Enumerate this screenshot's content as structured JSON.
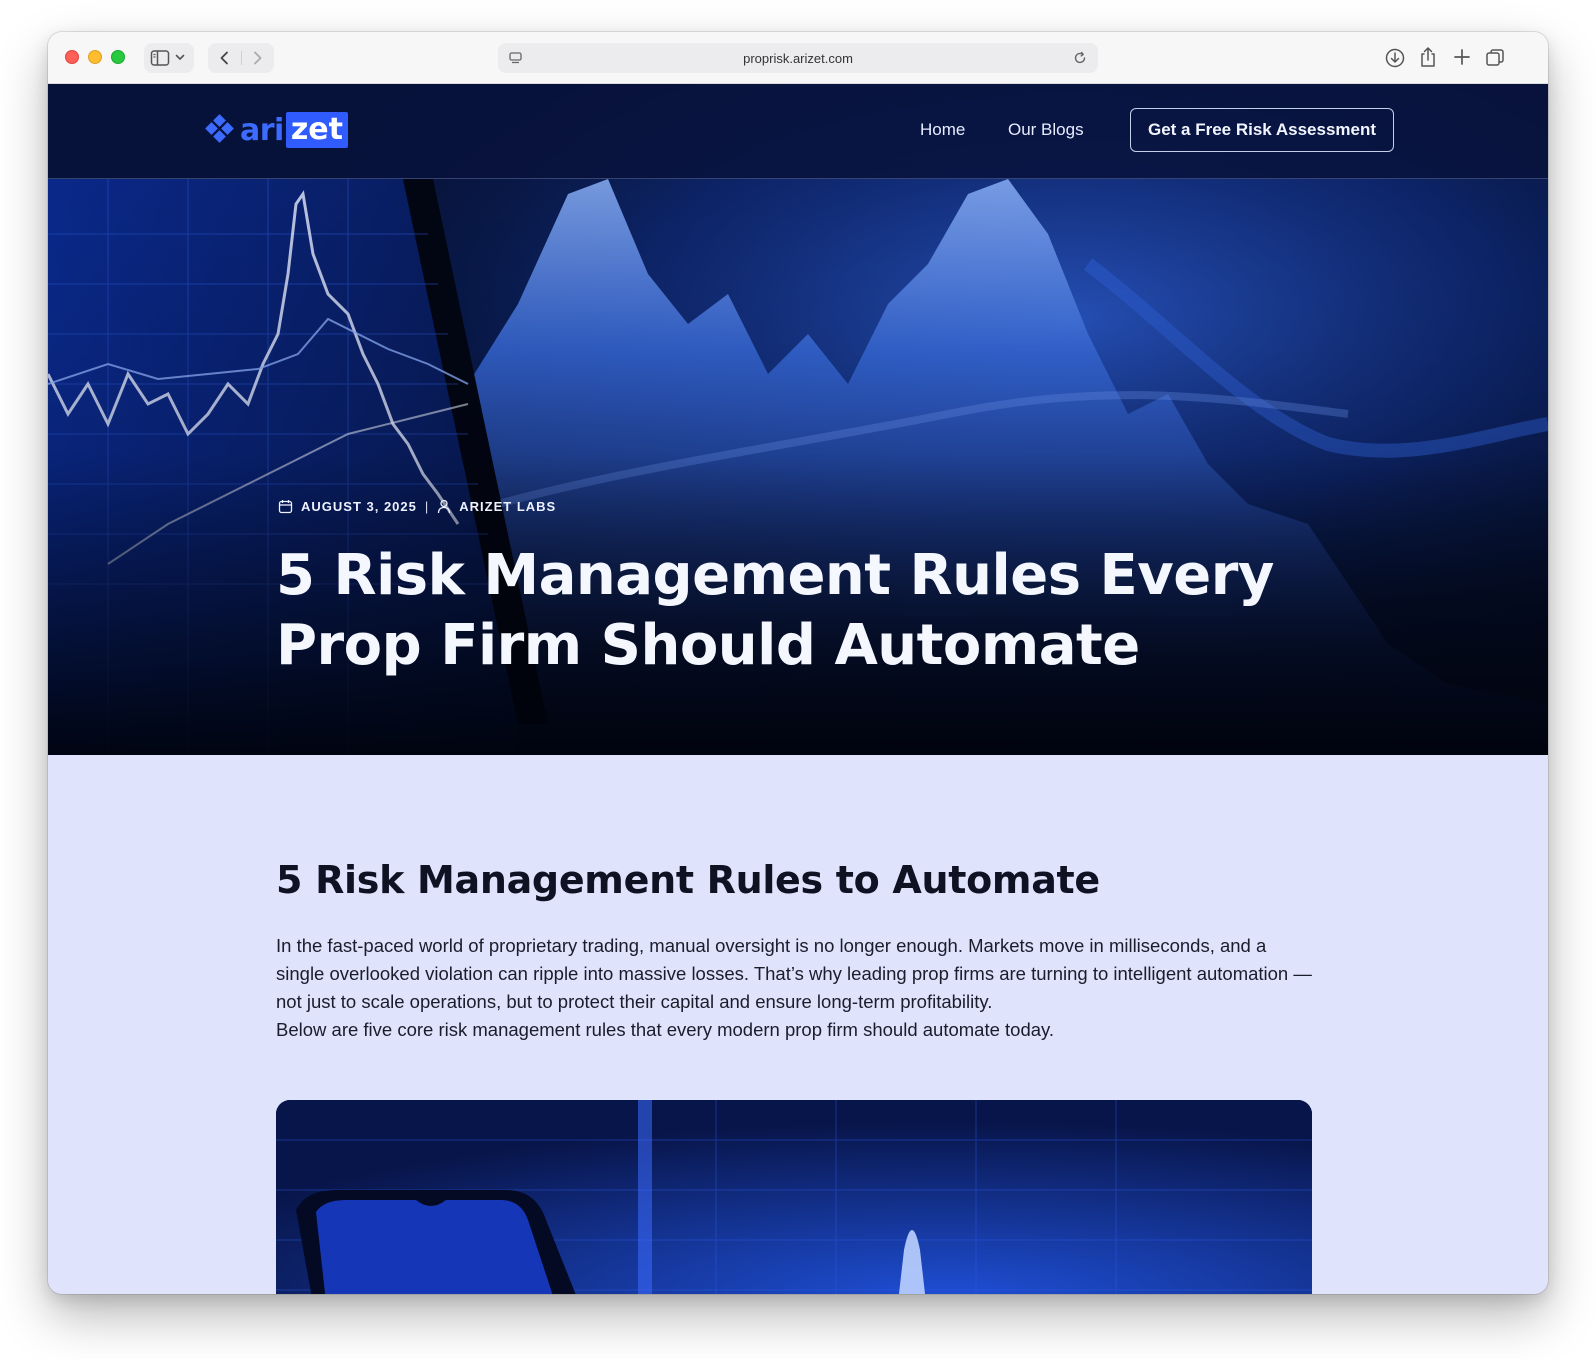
{
  "browser": {
    "url": "proprisk.arizet.com"
  },
  "site": {
    "logo": {
      "part1": "ari",
      "part2": "zet"
    },
    "nav": {
      "home": "Home",
      "blogs": "Our Blogs",
      "cta": "Get a Free Risk Assessment"
    }
  },
  "post": {
    "date": "AUGUST 3, 2025",
    "separator": "|",
    "author": "ARIZET LABS",
    "title": "5 Risk Management Rules Every Prop Firm Should Automate"
  },
  "article": {
    "heading": "5 Risk Management Rules to Automate",
    "paragraph1": "In the fast-paced world of proprietary trading, manual oversight is no longer enough. Markets move in milliseconds, and a single overlooked violation can ripple into massive losses. That’s why leading prop firms are turning to intelligent automation — not just to scale operations, but to protect their capital and ensure long-term profitability.",
    "paragraph2": "Below are five core risk management rules that every modern prop firm should automate today."
  },
  "colors": {
    "brand": "#2f5bff",
    "hero_bg": "#061236",
    "content_bg": "#dfe3fb"
  }
}
